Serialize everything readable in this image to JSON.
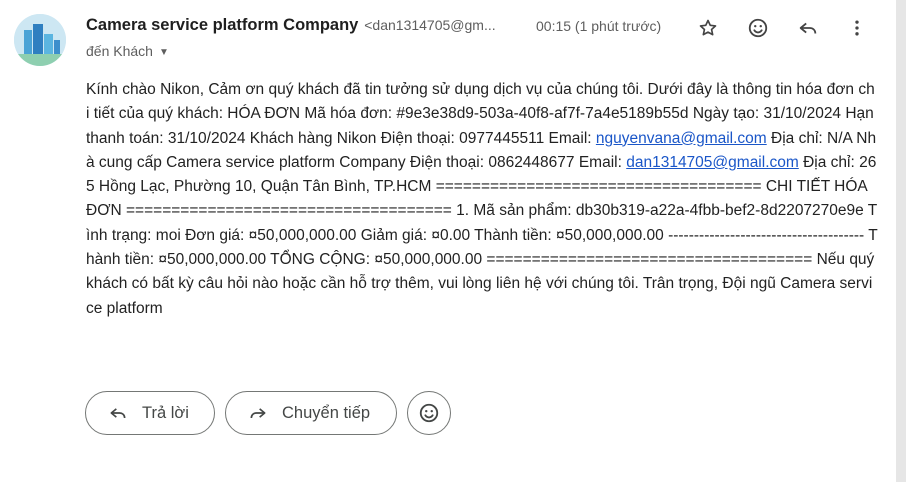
{
  "header": {
    "sender_name": "Camera service platform Company",
    "sender_email": "<dan1314705@gm...",
    "time": "00:15 (1 phút trước)",
    "to_label": "đến Khách"
  },
  "icons": {
    "star": "star-icon",
    "emoji": "emoji-icon",
    "reply": "reply-icon",
    "more": "more-vert-icon"
  },
  "body": {
    "part1": "Kính chào Nikon, Cảm ơn quý khách đã tin tưởng sử dụng dịch vụ của chúng tôi. Dưới đây là thông tin hóa đơn chi tiết của quý khách: HÓA ĐƠN Mã hóa đơn: #9e3e38d9-503a-40f8-af7f-7a4e5189b55d Ngày tạo: 31/10/2024 Hạn thanh toán: 31/10/2024 Khách hàng Nikon Điện thoại: 0977445511 Email: ",
    "customer_email": "nguyenvana@gmail.com",
    "part2": " Địa chỉ: N/A Nhà cung cấp Camera service platform Company Điện thoại: 0862448677 Email: ",
    "vendor_email": "dan1314705@gmail.com",
    "part3": " Địa chỉ: 265 Hồng Lạc, Phường 10, Quận Tân Bình, TP.HCM ==================================== CHI TIẾT HÓA ĐƠN ==================================== 1. Mã sản phẩm: db30b319-a22a-4fbb-bef2-8d2207270e9e Tình trạng: moi Đơn giá: ¤50,000,000.00 Giảm giá: ¤0.00 Thành tiền: ¤50,000,000.00 -------------------------------------- Thành tiền: ¤50,000,000.00 TỔNG CỘNG: ¤50,000,000.00 ==================================== Nếu quý khách có bất kỳ câu hỏi nào hoặc cần hỗ trợ thêm, vui lòng liên hệ với chúng tôi. Trân trọng, Đội ngũ Camera service platform"
  },
  "actions": {
    "reply_label": "Trả lời",
    "forward_label": "Chuyển tiếp"
  }
}
